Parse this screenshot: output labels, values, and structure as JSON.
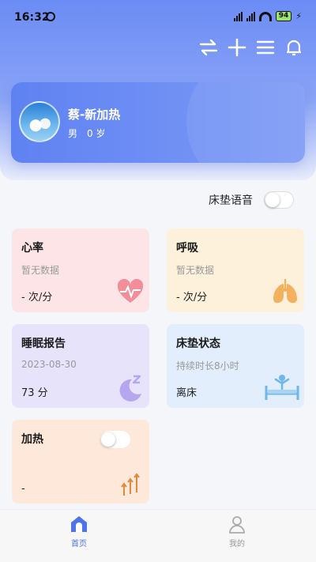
{
  "status_bar": {
    "time": "16:32",
    "battery": "94"
  },
  "header": {
    "icons": [
      "switch-icon",
      "add-icon",
      "menu-icon",
      "bell-icon"
    ]
  },
  "profile": {
    "name": "蔡-新加热",
    "gender": "男",
    "age": "0 岁"
  },
  "voice": {
    "label": "床垫语音",
    "enabled": false
  },
  "cards": {
    "heart": {
      "title": "心率",
      "subtitle": "暂无数据",
      "value": "- 次/分"
    },
    "breath": {
      "title": "呼吸",
      "subtitle": "暂无数据",
      "value": "- 次/分"
    },
    "sleep": {
      "title": "睡眠报告",
      "subtitle": "2023-08-30",
      "value": "73 分"
    },
    "bed": {
      "title": "床垫状态",
      "subtitle": "持续时长8小时",
      "value": "离床"
    },
    "heat": {
      "title": "加热",
      "value": "-",
      "enabled": false
    }
  },
  "tabbar": {
    "home_label": "首页",
    "mine_label": "我的",
    "active": "home"
  },
  "colors": {
    "accent": "#4d74e8",
    "header": "#6b8cf5"
  }
}
